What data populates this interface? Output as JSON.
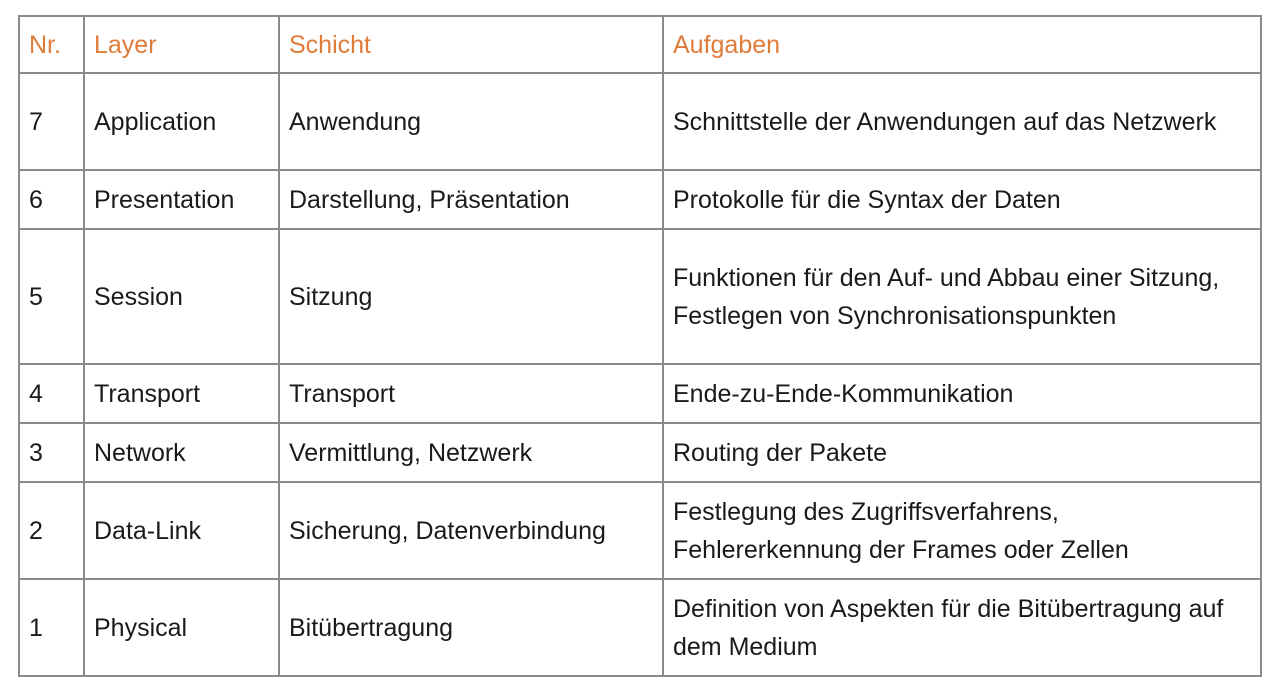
{
  "table": {
    "headers": [
      "Nr.",
      "Layer",
      "Schicht",
      "Aufgaben"
    ],
    "rows": [
      {
        "nr": "7",
        "layer": "Application",
        "schicht": "Anwendung",
        "aufgaben": "Schnittstelle der Anwendungen auf das Netzwerk"
      },
      {
        "nr": "6",
        "layer": "Presentation",
        "schicht": "Darstellung, Präsentation",
        "aufgaben": "Protokolle für die Syntax der Daten"
      },
      {
        "nr": "5",
        "layer": "Session",
        "schicht": "Sitzung",
        "aufgaben": "Funktionen für den Auf- und Abbau einer Sitzung, Festlegen von Synchronisationspunkten"
      },
      {
        "nr": "4",
        "layer": "Transport",
        "schicht": "Transport",
        "aufgaben": "Ende-zu-Ende-Kommunikation"
      },
      {
        "nr": "3",
        "layer": "Network",
        "schicht": "Vermittlung, Netzwerk",
        "aufgaben": "Routing der Pakete"
      },
      {
        "nr": "2",
        "layer": "Data-Link",
        "schicht": "Sicherung, Datenverbindung",
        "aufgaben": "Festlegung des Zugriffsverfahrens, Fehlererkennung der Frames oder Zellen"
      },
      {
        "nr": "1",
        "layer": "Physical",
        "schicht": "Bitübertragung",
        "aufgaben": "Definition von Aspekten für die Bitübertragung auf dem Medium"
      }
    ]
  },
  "colors": {
    "header_text": "#e07b39",
    "border": "#8a8a8a",
    "body_text": "#1a1a1a"
  }
}
